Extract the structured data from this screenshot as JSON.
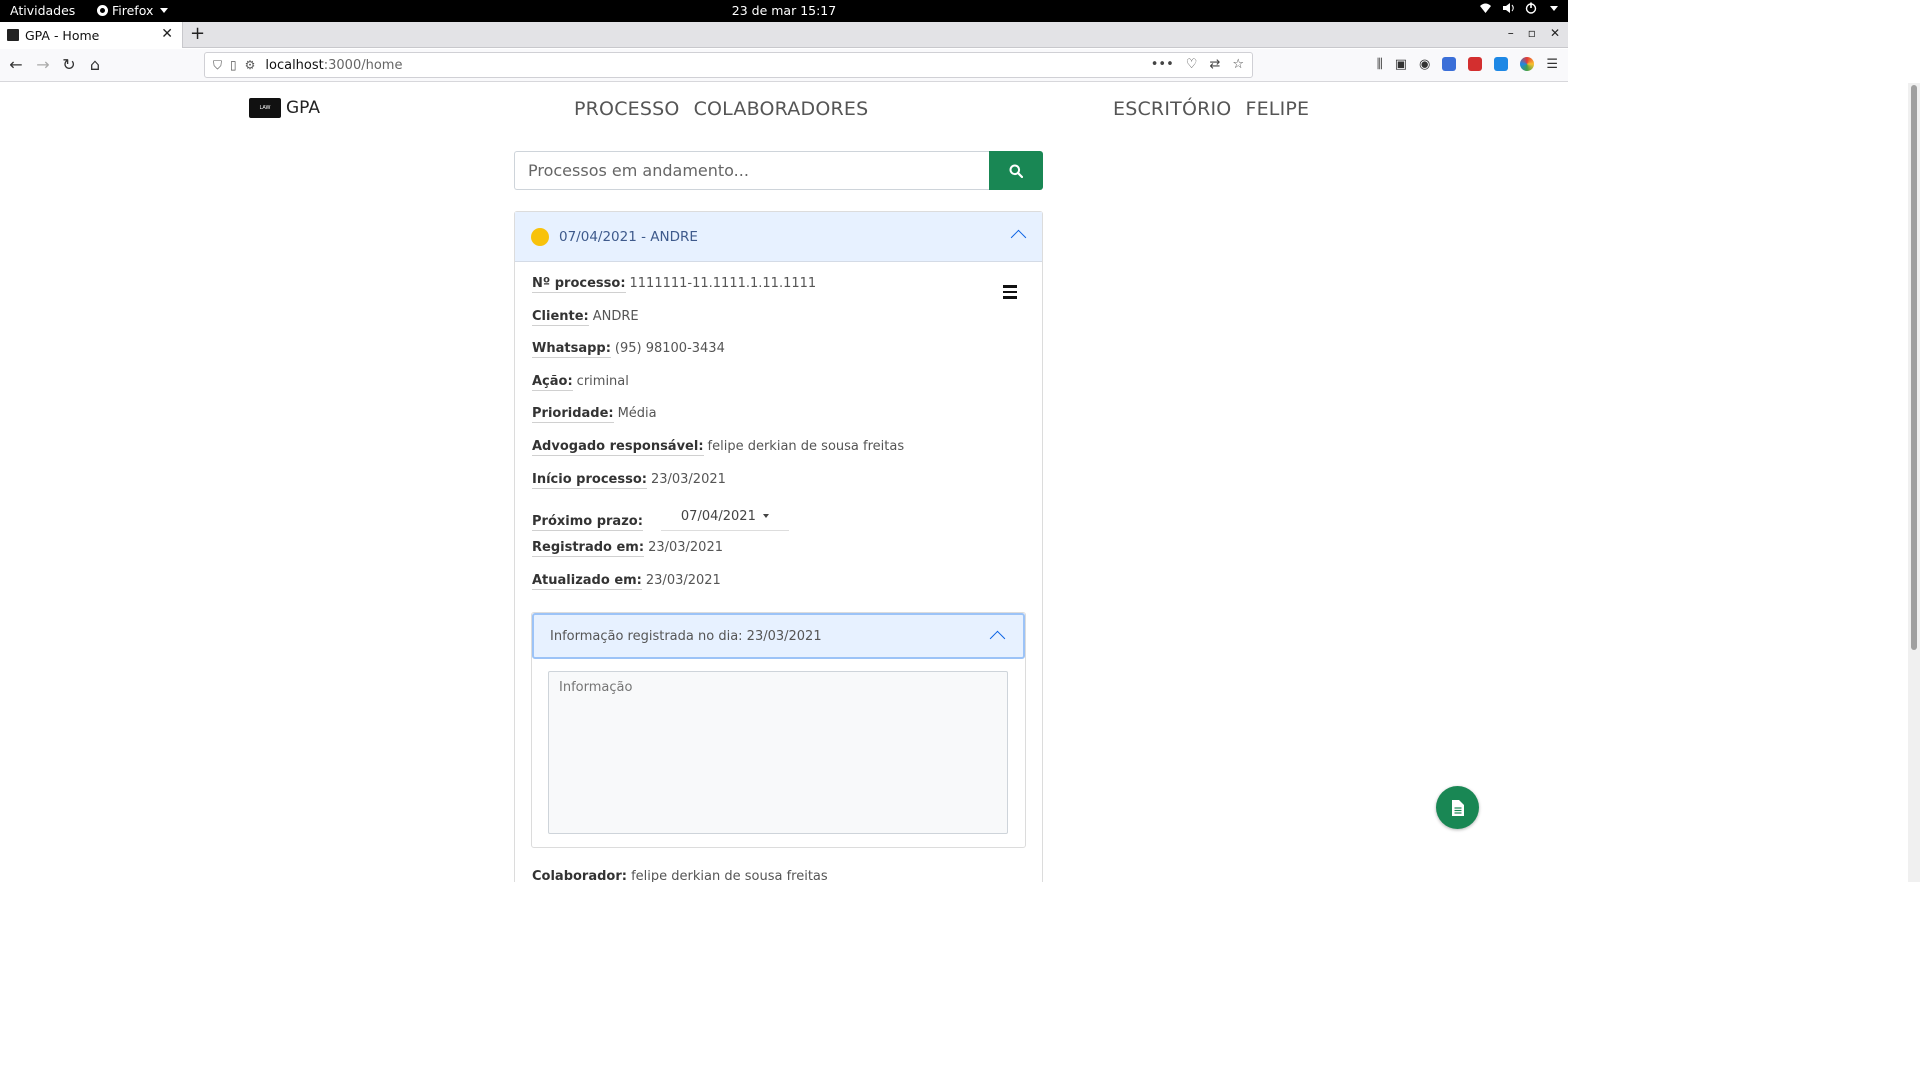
{
  "system": {
    "activities": "Atividades",
    "app_menu": "Firefox",
    "clock": "23 de mar  15:17"
  },
  "browser": {
    "tab_title": "GPA - Home",
    "url_host": "localhost",
    "url_path": ":3000/home"
  },
  "header": {
    "brand": "GPA",
    "nav_center": [
      "PROCESSO",
      "COLABORADORES"
    ],
    "nav_right": [
      "ESCRITÓRIO",
      "FELIPE"
    ]
  },
  "search": {
    "placeholder": "Processos em andamento..."
  },
  "process": {
    "header_title": "07/04/2021 - ANDRE",
    "status_color": "#f8c20b",
    "fields": [
      {
        "label": "Nº processo:",
        "value": "1111111-11.1111.1.11.1111"
      },
      {
        "label": "Cliente:",
        "value": "ANDRE"
      },
      {
        "label": "Whatsapp:",
        "value": "(95) 98100-3434"
      },
      {
        "label": "Ação:",
        "value": "criminal"
      },
      {
        "label": "Prioridade:",
        "value": "Média"
      },
      {
        "label": "Advogado responsável:",
        "value": "felipe derkian de sousa freitas"
      },
      {
        "label": "Início processo:",
        "value": "23/03/2021"
      }
    ],
    "next_deadline_label": "Próximo prazo:",
    "next_deadline_value": "07/04/2021",
    "registered_label": "Registrado em:",
    "registered_value": "23/03/2021",
    "updated_label": "Atualizado em:",
    "updated_value": "23/03/2021",
    "info_header": "Informação registrada no dia: 23/03/2021",
    "info_placeholder": "Informação",
    "collaborator_label": "Colaborador:",
    "collaborator_value": "felipe derkian de sousa freitas"
  },
  "colors": {
    "accent_green": "#198754",
    "accordion_bg": "#e7f1ff"
  }
}
